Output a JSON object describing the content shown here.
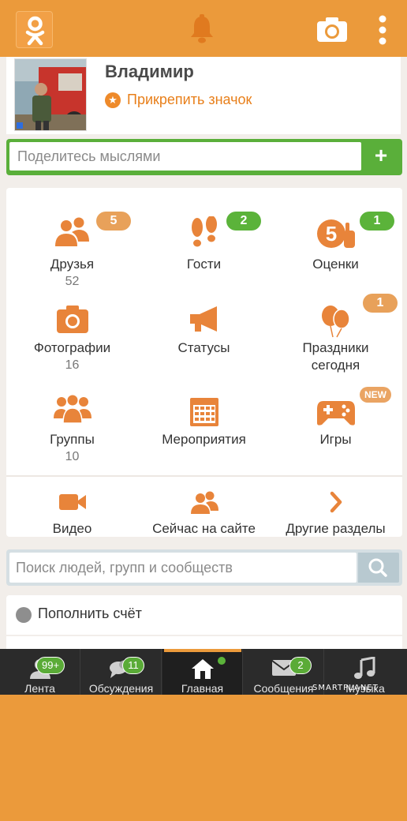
{
  "profile": {
    "name": "Владимир",
    "badge_link": "Прикрепить значок"
  },
  "post": {
    "placeholder": "Поделитесь мыслями",
    "add_label": "+"
  },
  "grid": {
    "items": [
      {
        "label": "Друзья",
        "count": "52",
        "badge": "5",
        "badge_color": "orange",
        "icon": "friends-icon"
      },
      {
        "label": "Гости",
        "count": "",
        "badge": "2",
        "badge_color": "green",
        "icon": "footprints-icon"
      },
      {
        "label": "Оценки",
        "count": "",
        "badge": "1",
        "badge_color": "green",
        "icon": "rating-icon"
      },
      {
        "label": "Фотографии",
        "count": "16",
        "badge": "",
        "icon": "photo-icon"
      },
      {
        "label": "Статусы",
        "count": "",
        "badge": "",
        "icon": "megaphone-icon"
      },
      {
        "label": "Праздники",
        "label2": "сегодня",
        "badge": "1",
        "badge_color": "orange",
        "icon": "balloons-icon"
      },
      {
        "label": "Группы",
        "count": "10",
        "badge": "",
        "icon": "groups-icon"
      },
      {
        "label": "Мероприятия",
        "count": "",
        "badge": "",
        "icon": "calendar-icon"
      },
      {
        "label": "Игры",
        "count": "",
        "badge": "NEW",
        "badge_color": "orange",
        "icon": "gamepad-icon"
      }
    ],
    "quick": [
      {
        "label": "Видео",
        "icon": "video-icon"
      },
      {
        "label": "Сейчас на сайте",
        "icon": "online-users-icon"
      },
      {
        "label": "Другие разделы",
        "icon": "chevron-right-icon"
      }
    ]
  },
  "search": {
    "placeholder": "Поиск людей, групп и сообществ"
  },
  "topup": {
    "label": "Пополнить счёт"
  },
  "bottom_nav": [
    {
      "label": "Лента",
      "badge": "99+",
      "icon": "feed-icon"
    },
    {
      "label": "Обсуждения",
      "badge": "11",
      "icon": "discussions-icon"
    },
    {
      "label": "Главная",
      "badge": "",
      "icon": "home-icon",
      "active": true
    },
    {
      "label": "Сообщения",
      "badge": "2",
      "icon": "messages-icon"
    },
    {
      "label": "Музыка",
      "badge": "",
      "icon": "music-icon"
    }
  ],
  "watermark": "SMARTPLANET",
  "colors": {
    "brand_orange": "#eb9a3b",
    "icon_orange": "#e8843a",
    "badge_green": "#5bb33a",
    "nav_dark": "#2b2b2b"
  }
}
